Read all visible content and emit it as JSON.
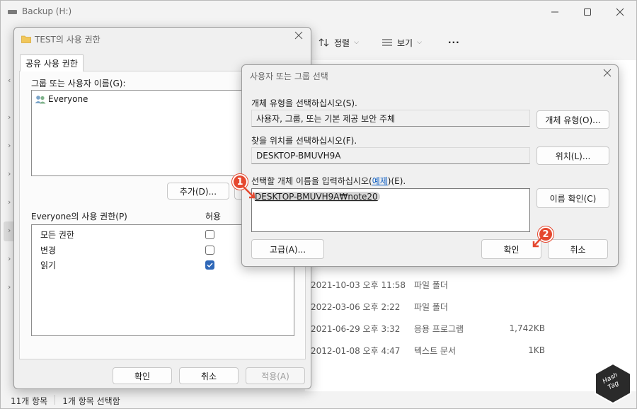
{
  "explorer": {
    "title": "Backup (H:)",
    "toolbar": {
      "sort_label": "정렬",
      "view_label": "보기",
      "more_label": "···"
    },
    "files": [
      {
        "date": "2021-10-03 오후 11:58",
        "type": "파일 폴더",
        "size": ""
      },
      {
        "date": "2022-03-06 오후 2:22",
        "type": "파일 폴더",
        "size": ""
      },
      {
        "date": "2021-06-29 오후 3:32",
        "type": "응용 프로그램",
        "size": "1,742KB"
      },
      {
        "date": "2012-01-08 오후 4:47",
        "type": "텍스트 문서",
        "size": "1KB"
      }
    ],
    "status": {
      "count": "11개 항목",
      "selected": "1개 항목 선택함"
    }
  },
  "perm_dialog": {
    "title": "TEST의 사용 권한",
    "tab_label": "공유 사용 권한",
    "group_label": "그룹 또는 사용자 이름(G):",
    "group_item": "Everyone",
    "add_button": "추가(D)...",
    "perm_label": "Everyone의 사용 권한(P)",
    "allow_header": "허용",
    "permissions": [
      {
        "name": "모든 권한",
        "allow": false
      },
      {
        "name": "변경",
        "allow": false
      },
      {
        "name": "읽기",
        "allow": true
      }
    ],
    "ok_button": "확인",
    "cancel_button": "취소",
    "apply_button": "적용(A)"
  },
  "select_dialog": {
    "title": "사용자 또는 그룹 선택",
    "object_type_label": "개체 유형을 선택하십시오(S).",
    "object_type_value": "사용자, 그룹, 또는 기본 제공 보안 주체",
    "object_type_button": "개체 유형(O)...",
    "location_label": "찾을 위치를 선택하십시오(F).",
    "location_value": "DESKTOP-BMUVH9A",
    "location_button": "위치(L)...",
    "enter_label_prefix": "선택할 개체 이름을 입력하십시오(",
    "enter_label_link": "예제",
    "enter_label_suffix": ")(E).",
    "entered_name": "DESKTOP-BMUVH9A₩note20",
    "check_names_button": "이름 확인(C)",
    "advanced_button": "고급(A)...",
    "ok_button": "확인",
    "cancel_button": "취소"
  },
  "badges": {
    "one": "1",
    "two": "2"
  },
  "watermark": {
    "line1": "Hash",
    "line2": "Tag"
  },
  "icons": {
    "sort": "sort-icon",
    "view": "view-icon",
    "folder": "folder-icon",
    "users": "users-icon",
    "close": "close-icon",
    "check": "check-icon"
  },
  "colors": {
    "accent": "#2f68b8",
    "badge": "#e5482f",
    "link": "#0b5cc2"
  }
}
